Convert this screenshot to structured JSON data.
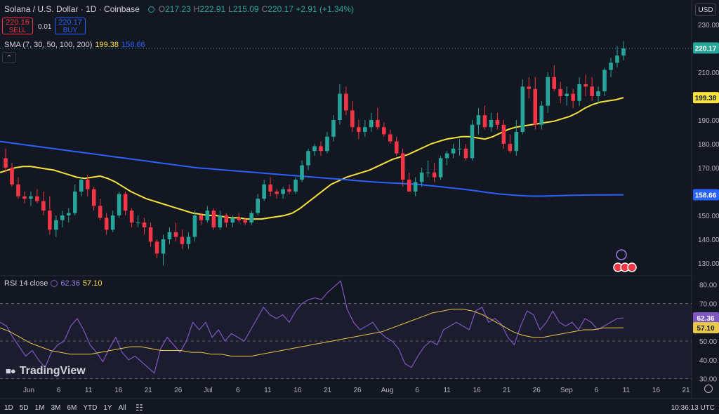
{
  "header": {
    "symbol_line": "Solana / U.S. Dollar · 1D · Coinbase",
    "o_label": "O",
    "o_value": "217.23",
    "h_label": "H",
    "h_value": "222.91",
    "l_label": "L",
    "l_value": "215.09",
    "c_label": "C",
    "c_value": "220.17 +2.91 (+1.34%)"
  },
  "trade": {
    "sell_price": "220.16",
    "sell_label": "SELL",
    "spread": "0.01",
    "buy_price": "220.17",
    "buy_label": "BUY"
  },
  "sma_legend": {
    "label": "SMA (7, 30, 50, 100, 200)",
    "v1": "199.38",
    "v2": "158.66"
  },
  "rsi_legend": {
    "label": "RSI 14 close",
    "v1": "62.36",
    "v2": "57.10"
  },
  "currency": "USD",
  "brand": "TradingView",
  "timeframes": [
    "1D",
    "5D",
    "1M",
    "3M",
    "6M",
    "YTD",
    "1Y",
    "All"
  ],
  "clock": "10:36:13 UTC",
  "colors": {
    "up": "#26a69a",
    "down": "#f23645",
    "sma_short": "#f7e23d",
    "sma_long": "#2962ff",
    "rsi": "#7e57c2",
    "rsi_ma": "#e8c74a",
    "background": "#131722"
  },
  "chart_data": [
    {
      "type": "candlestick",
      "title": "Solana / U.S. Dollar · 1D · Coinbase",
      "x_tick_labels": [
        "Jun",
        "6",
        "11",
        "16",
        "21",
        "26",
        "Jul",
        "6",
        "11",
        "16",
        "21",
        "26",
        "Aug",
        "6",
        "11",
        "16",
        "21",
        "26",
        "Sep",
        "6",
        "11",
        "16",
        "21"
      ],
      "y_tick_labels": [
        "130.00",
        "140.00",
        "150.00",
        "160.00",
        "170.00",
        "180.00",
        "190.00",
        "200.00",
        "210.00",
        "220.00",
        "230.00"
      ],
      "ylim": [
        125,
        235
      ],
      "price_labels": {
        "last": "220.17",
        "sma_short": "199.38",
        "sma_long": "158.66"
      },
      "candles": [
        [
          174,
          178,
          168,
          170
        ],
        [
          170,
          172,
          162,
          163
        ],
        [
          163,
          166,
          157,
          158
        ],
        [
          158,
          160,
          155,
          157
        ],
        [
          157,
          160,
          154,
          158
        ],
        [
          158,
          161,
          155,
          156
        ],
        [
          156,
          160,
          150,
          152
        ],
        [
          152,
          158,
          142,
          144
        ],
        [
          144,
          150,
          141,
          148
        ],
        [
          148,
          152,
          145,
          150
        ],
        [
          150,
          153,
          147,
          151
        ],
        [
          151,
          163,
          150,
          160
        ],
        [
          160,
          166,
          158,
          165
        ],
        [
          165,
          167,
          158,
          161
        ],
        [
          161,
          162,
          152,
          154
        ],
        [
          154,
          157,
          148,
          149
        ],
        [
          149,
          151,
          142,
          144
        ],
        [
          144,
          152,
          143,
          150
        ],
        [
          150,
          160,
          149,
          159
        ],
        [
          159,
          160,
          150,
          152
        ],
        [
          152,
          153,
          145,
          147
        ],
        [
          147,
          150,
          145,
          147
        ],
        [
          147,
          149,
          142,
          145
        ],
        [
          145,
          147,
          137,
          139
        ],
        [
          139,
          140,
          132,
          134
        ],
        [
          134,
          142,
          129,
          140
        ],
        [
          140,
          145,
          138,
          143
        ],
        [
          143,
          147,
          139,
          141
        ],
        [
          141,
          144,
          136,
          138
        ],
        [
          138,
          143,
          136,
          141
        ],
        [
          141,
          152,
          139,
          150
        ],
        [
          150,
          151,
          146,
          148
        ],
        [
          148,
          154,
          147,
          152
        ],
        [
          152,
          153,
          144,
          145
        ],
        [
          145,
          152,
          144,
          150
        ],
        [
          150,
          151,
          145,
          147
        ],
        [
          147,
          150,
          145,
          149
        ],
        [
          149,
          151,
          147,
          148
        ],
        [
          148,
          149,
          146,
          147
        ],
        [
          147,
          152,
          146,
          151
        ],
        [
          151,
          159,
          150,
          157
        ],
        [
          157,
          165,
          156,
          163
        ],
        [
          163,
          166,
          158,
          160
        ],
        [
          160,
          161,
          157,
          159
        ],
        [
          159,
          162,
          157,
          161
        ],
        [
          161,
          163,
          159,
          160
        ],
        [
          160,
          166,
          159,
          165
        ],
        [
          165,
          173,
          164,
          171
        ],
        [
          171,
          178,
          169,
          177
        ],
        [
          177,
          180,
          175,
          179
        ],
        [
          179,
          181,
          175,
          177
        ],
        [
          177,
          185,
          176,
          183
        ],
        [
          183,
          192,
          181,
          190
        ],
        [
          190,
          205,
          188,
          201
        ],
        [
          201,
          204,
          192,
          194
        ],
        [
          194,
          198,
          185,
          187
        ],
        [
          187,
          190,
          182,
          185
        ],
        [
          185,
          190,
          183,
          187
        ],
        [
          187,
          193,
          185,
          190
        ],
        [
          190,
          195,
          186,
          187
        ],
        [
          187,
          189,
          183,
          184
        ],
        [
          184,
          186,
          180,
          181
        ],
        [
          181,
          183,
          175,
          176
        ],
        [
          176,
          178,
          162,
          165
        ],
        [
          165,
          168,
          160,
          160
        ],
        [
          160,
          166,
          158,
          164
        ],
        [
          164,
          170,
          162,
          168
        ],
        [
          168,
          173,
          166,
          168
        ],
        [
          168,
          172,
          164,
          166
        ],
        [
          166,
          175,
          165,
          174
        ],
        [
          174,
          177,
          171,
          176
        ],
        [
          176,
          180,
          174,
          178
        ],
        [
          178,
          182,
          175,
          178
        ],
        [
          178,
          180,
          173,
          174
        ],
        [
          174,
          190,
          173,
          188
        ],
        [
          188,
          195,
          184,
          192
        ],
        [
          192,
          196,
          186,
          187
        ],
        [
          187,
          193,
          185,
          190
        ],
        [
          190,
          193,
          186,
          188
        ],
        [
          188,
          190,
          178,
          180
        ],
        [
          180,
          184,
          176,
          177
        ],
        [
          177,
          190,
          175,
          185
        ],
        [
          185,
          207,
          184,
          204
        ],
        [
          204,
          208,
          199,
          203
        ],
        [
          203,
          208,
          186,
          188
        ],
        [
          188,
          198,
          186,
          196
        ],
        [
          196,
          210,
          193,
          208
        ],
        [
          208,
          213,
          202,
          203
        ],
        [
          203,
          206,
          197,
          200
        ],
        [
          200,
          204,
          196,
          201
        ],
        [
          201,
          203,
          195,
          198
        ],
        [
          198,
          208,
          196,
          205
        ],
        [
          205,
          209,
          200,
          204
        ],
        [
          204,
          208,
          198,
          200
        ],
        [
          200,
          204,
          197,
          202
        ],
        [
          202,
          212,
          200,
          211
        ],
        [
          211,
          216,
          208,
          214
        ],
        [
          214,
          221,
          212,
          217
        ],
        [
          217,
          223,
          215,
          220
        ]
      ],
      "series": [
        {
          "name": "SMA",
          "values": [
            168,
            169,
            170,
            170.5,
            170.5,
            170,
            169.5,
            169,
            168,
            167,
            166,
            165.5,
            166,
            166.5,
            165.5,
            164,
            162,
            160,
            158.5,
            157,
            156,
            155,
            154,
            153,
            152,
            151,
            150.5,
            150,
            150,
            149.5,
            149,
            149,
            148.5,
            148.5,
            148.5,
            149,
            149.5,
            150,
            151,
            153,
            155.5,
            158,
            160.5,
            163,
            164.5,
            166,
            167,
            168,
            169,
            170.5,
            172,
            173.5,
            174.5,
            175.5,
            177,
            178.5,
            180,
            181,
            182,
            182.5,
            183,
            183,
            182.5,
            182,
            183,
            184.5,
            186,
            187,
            187.5,
            188,
            188.5,
            189,
            189.5,
            190.5,
            191.5,
            193,
            195,
            196.5,
            197.5,
            198,
            198.5,
            199.38
          ]
        },
        {
          "name": "SMA",
          "values": [
            181,
            180.5,
            180,
            179.5,
            179,
            178.5,
            178,
            177.5,
            177,
            176.5,
            176,
            175.5,
            175,
            174.5,
            174,
            173.5,
            173,
            172.5,
            172,
            171.5,
            171,
            170.5,
            170,
            169.7,
            169.4,
            169.1,
            168.8,
            168.5,
            168.2,
            167.9,
            167.6,
            167.3,
            167,
            166.7,
            166.4,
            166.1,
            165.8,
            165.5,
            165.2,
            164.9,
            164.6,
            164.3,
            164,
            163.8,
            163.6,
            163.4,
            163.2,
            163,
            162.6,
            162.2,
            161.8,
            161.4,
            161,
            160.5,
            160,
            159.5,
            159,
            158.7,
            158.4,
            158.2,
            158.1,
            158.1,
            158.2,
            158.3,
            158.4,
            158.5,
            158.55,
            158.6,
            158.62,
            158.64,
            158.66
          ]
        }
      ]
    },
    {
      "type": "line",
      "title": "RSI 14 close",
      "y_tick_labels": [
        "30.00",
        "40.00",
        "50.00",
        "60.00",
        "70.00",
        "80.00"
      ],
      "ylim": [
        28,
        84
      ],
      "bands": [
        30,
        50,
        70
      ],
      "price_labels": {
        "rsi": "62.36",
        "rsi_ma": "57.10"
      },
      "series": [
        {
          "name": "RSI",
          "values": [
            60,
            58,
            52,
            47,
            42,
            45,
            40,
            36,
            44,
            48,
            50,
            58,
            62,
            56,
            48,
            44,
            39,
            46,
            52,
            44,
            40,
            42,
            39,
            36,
            33,
            46,
            52,
            48,
            44,
            50,
            60,
            56,
            60,
            52,
            56,
            50,
            54,
            52,
            50,
            56,
            62,
            68,
            64,
            62,
            64,
            60,
            66,
            70,
            72,
            73,
            72,
            76,
            79,
            82,
            67,
            60,
            56,
            58,
            60,
            55,
            52,
            50,
            46,
            38,
            36,
            42,
            47,
            50,
            48,
            56,
            58,
            60,
            58,
            56,
            66,
            68,
            60,
            62,
            59,
            52,
            48,
            58,
            66,
            64,
            56,
            60,
            66,
            60,
            58,
            60,
            56,
            62,
            60,
            56,
            58,
            60,
            62,
            62.36
          ]
        },
        {
          "name": "RSI MA",
          "values": [
            57,
            55,
            52,
            49,
            47,
            45,
            44,
            43,
            43,
            43,
            44,
            45,
            46,
            47,
            47,
            46,
            45,
            45,
            45,
            44,
            44,
            43,
            43,
            42,
            42,
            42,
            43,
            44,
            45,
            46,
            47,
            48,
            49,
            50,
            51,
            52,
            53,
            54,
            55,
            57,
            59,
            61,
            63,
            65,
            66,
            67,
            67,
            66,
            64,
            61,
            58,
            55,
            53,
            52,
            52,
            53,
            54,
            55,
            56,
            56,
            57,
            57,
            57.1
          ]
        }
      ]
    }
  ]
}
